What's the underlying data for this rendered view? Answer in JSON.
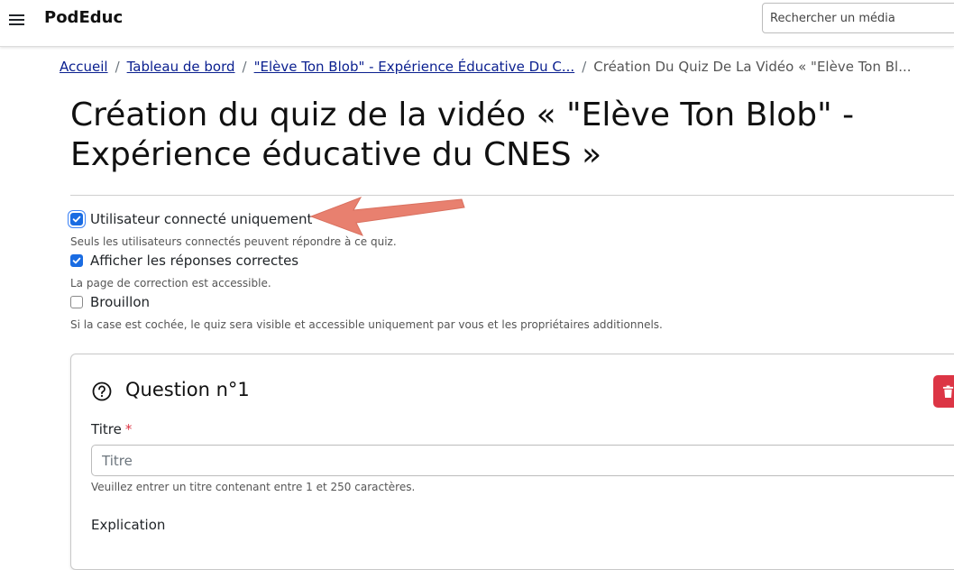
{
  "header": {
    "brand": "PodEduc",
    "search_placeholder": "Rechercher un média"
  },
  "breadcrumb": {
    "items": [
      "Accueil",
      "Tableau de bord",
      "\"Elève Ton Blob\" - Expérience Éducative Du C..."
    ],
    "current": "Création Du Quiz De La Vidéo « \"Elève Ton Bl...",
    "separator": "/"
  },
  "page": {
    "title": "Création du quiz de la vidéo « \"Elève Ton Blob\" - Expérience éducative du CNES »"
  },
  "options": [
    {
      "label": "Utilisateur connecté uniquement",
      "checked": true,
      "help": "Seuls les utilisateurs connectés peuvent répondre à ce quiz."
    },
    {
      "label": "Afficher les réponses correctes",
      "checked": true,
      "help": "La page de correction est accessible."
    },
    {
      "label": "Brouillon",
      "checked": false,
      "help": "Si la case est cochée, le quiz sera visible et accessible uniquement par vous et les propriétaires additionnels."
    }
  ],
  "question": {
    "heading": "Question n°1",
    "title_label": "Titre",
    "required_mark": "*",
    "title_placeholder": "Titre",
    "title_help": "Veuillez entrer un titre contenant entre 1 et 250 caractères.",
    "explanation_label": "Explication"
  },
  "colors": {
    "link": "#0a1f8f",
    "checkbox": "#1a6ce2",
    "danger": "#dc3545",
    "annotation_arrow": "#e8806f"
  },
  "icons": {
    "menu": "hamburger-menu-icon",
    "question": "question-circle-icon",
    "delete": "trash-icon",
    "check": "check-icon"
  }
}
